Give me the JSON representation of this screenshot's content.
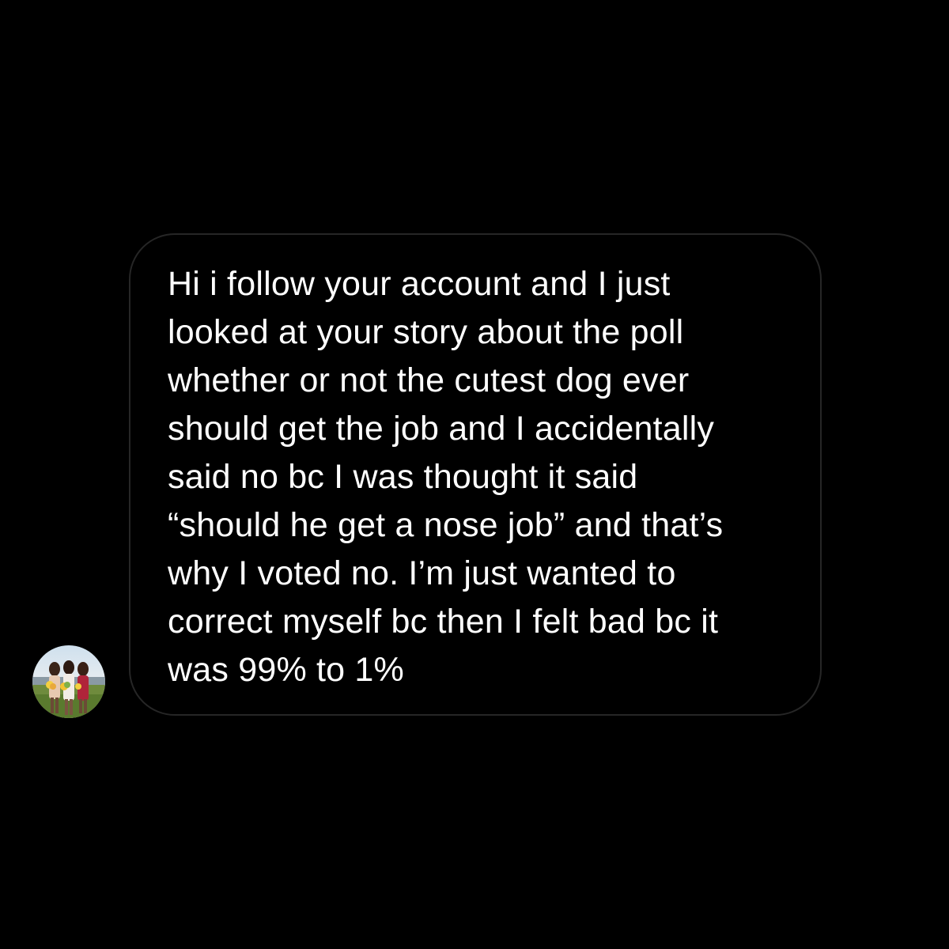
{
  "conversation": {
    "avatar_icon": "profile-photo-avatar",
    "message": {
      "lines": [
        "Hi i follow your account and I just",
        "looked at your story about the poll",
        "whether or not the cutest dog ever",
        "should get the job and I accidentally",
        "said no bc I was thought it said",
        "“should he get a nose job” and that’s",
        "why I voted no. I’m just wanted to",
        "correct myself bc then I felt bad bc it",
        "was 99% to 1%"
      ]
    }
  },
  "colors": {
    "background": "#000000",
    "bubble_border": "#262626",
    "text": "#ffffff"
  }
}
